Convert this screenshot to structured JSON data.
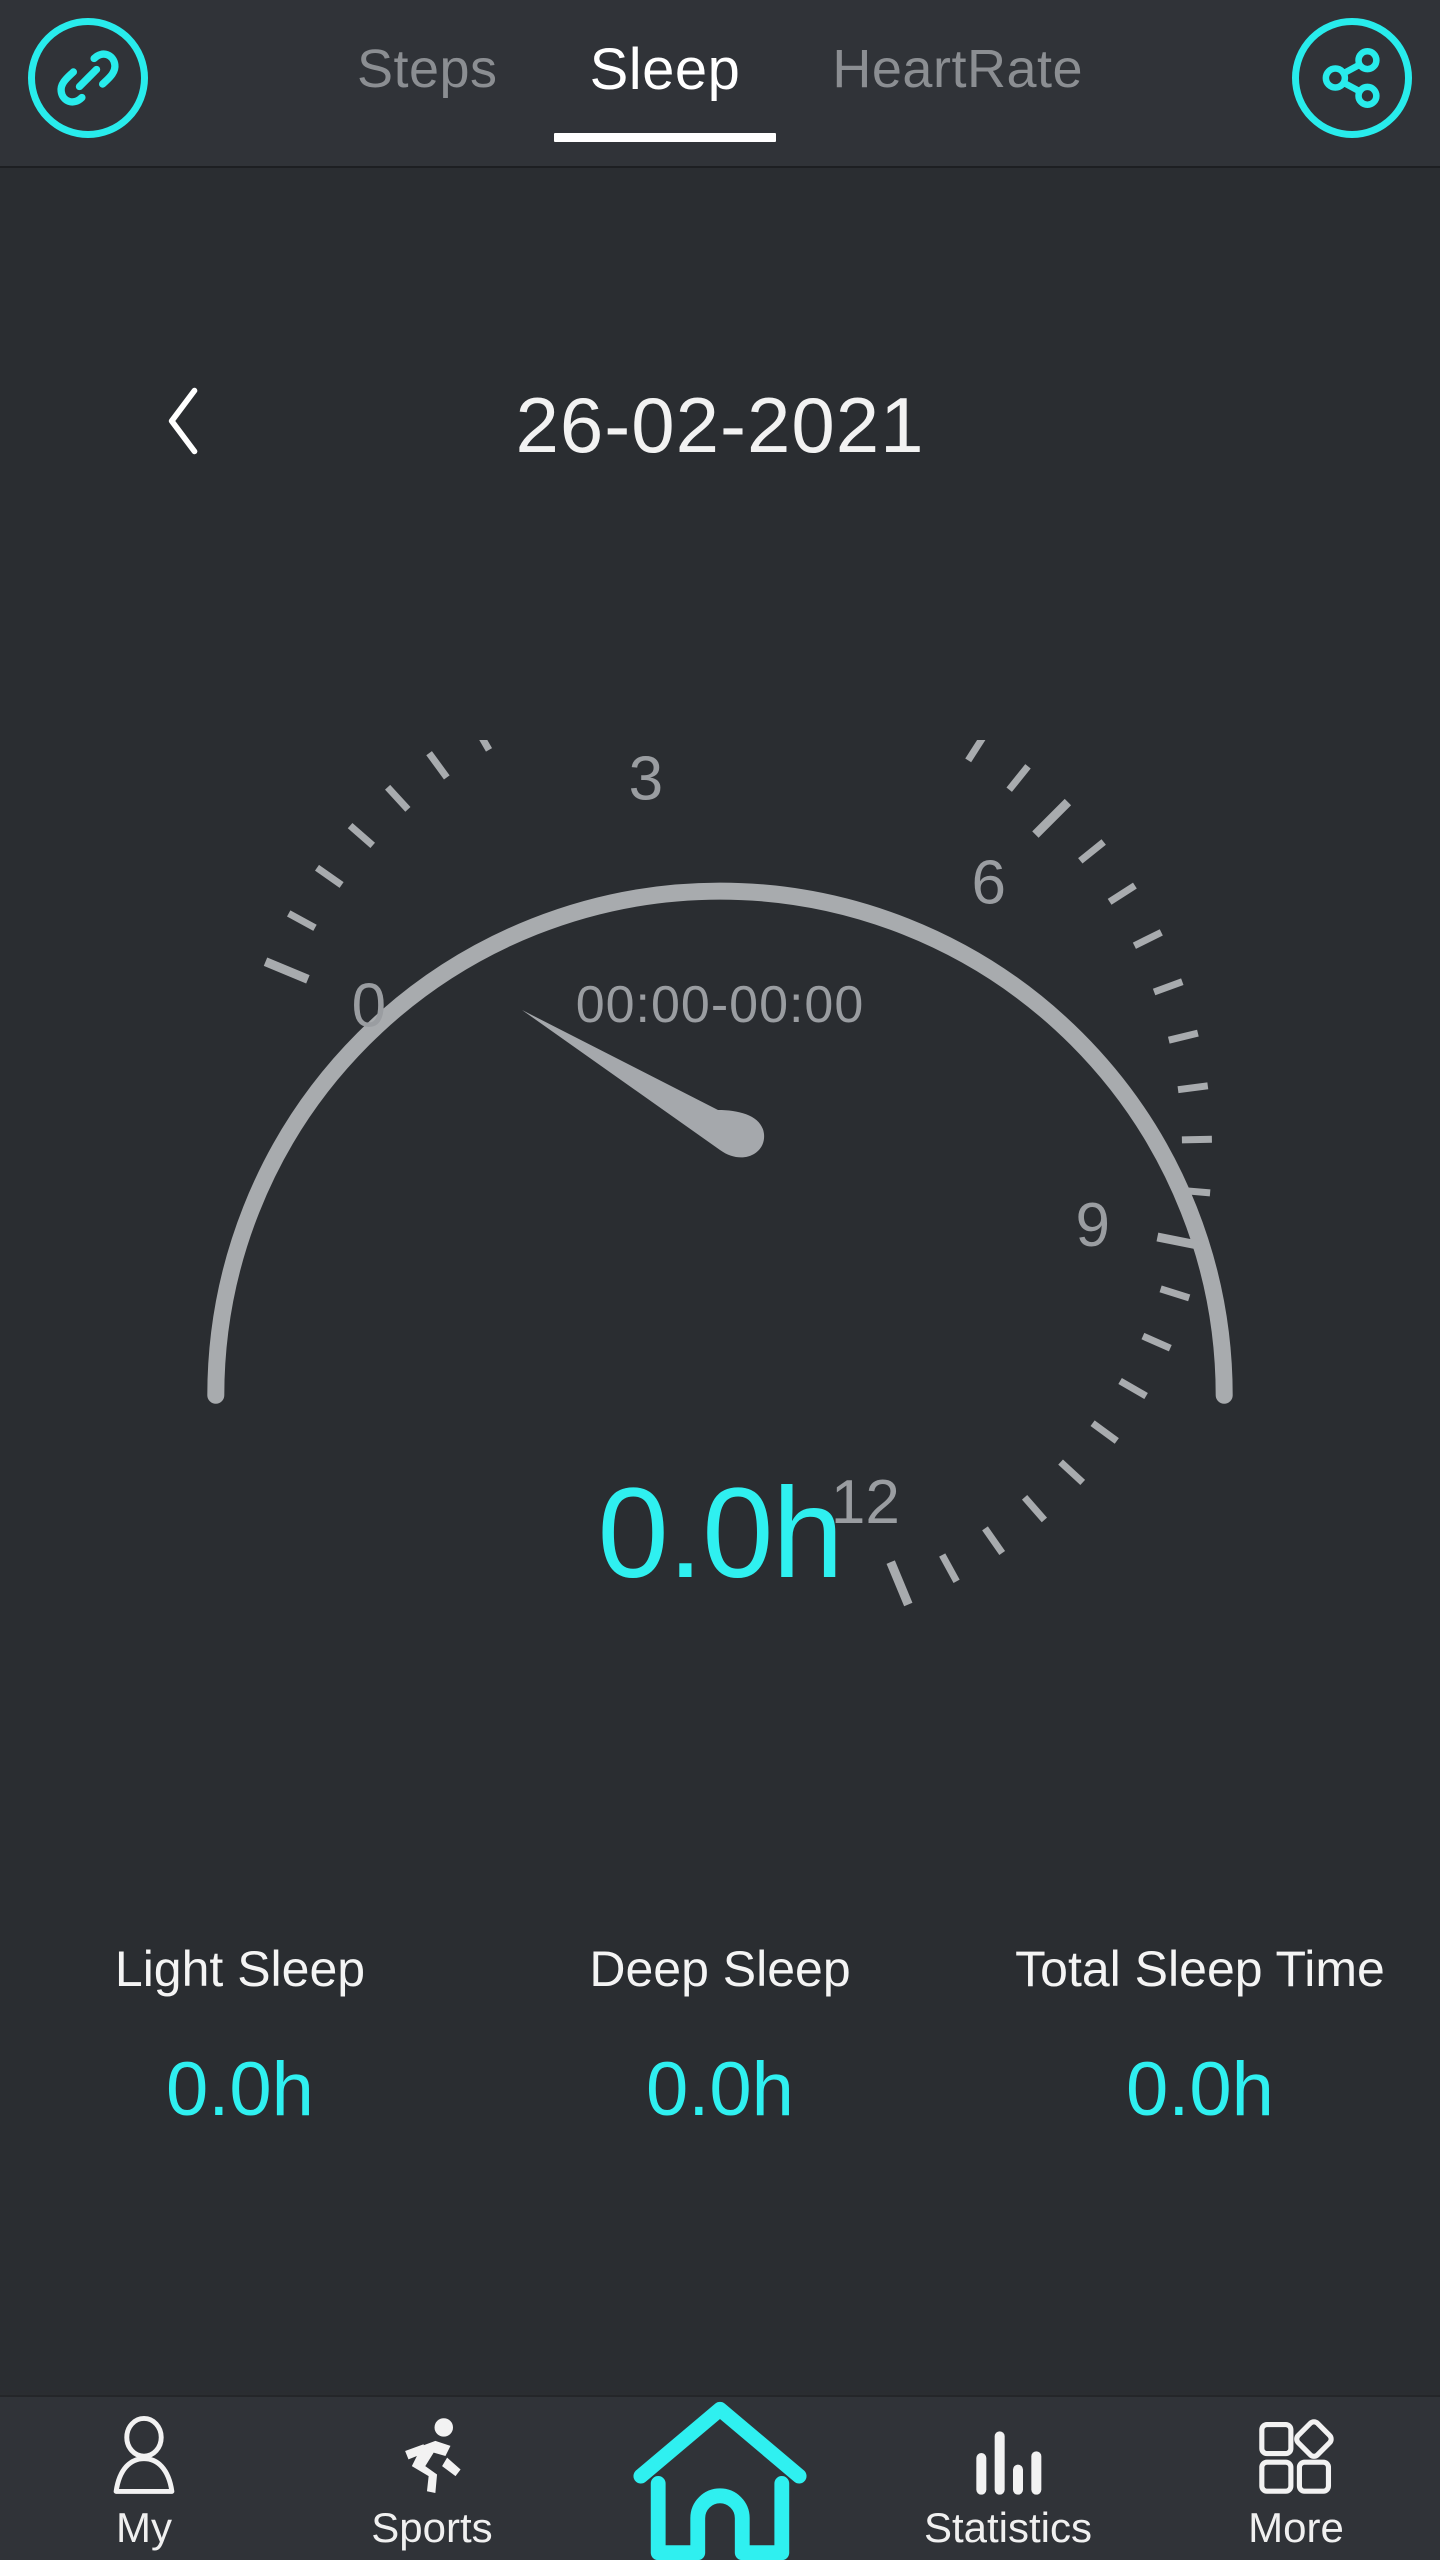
{
  "theme": {
    "accent": "#2ff0f0",
    "header_bg": "#303338",
    "body_bg": "#2a2d31",
    "gauge_gray": "#a8abae",
    "muted_text": "#8b8e92"
  },
  "topbar": {
    "link_icon": "chain-link-icon",
    "share_icon": "share-icon",
    "tabs": [
      {
        "label": "Steps",
        "active": false
      },
      {
        "label": "Sleep",
        "active": true
      },
      {
        "label": "HeartRate",
        "active": false
      }
    ]
  },
  "date_nav": {
    "back_icon": "chevron-left-icon",
    "date": "26-02-2021"
  },
  "gauge": {
    "time_range": "00:00-00:00",
    "value": "0.0h",
    "tick_labels": [
      "0",
      "3",
      "6",
      "9",
      "12"
    ],
    "needle_icon": "gauge-needle"
  },
  "stats": [
    {
      "label": "Light Sleep",
      "value": "0.0h"
    },
    {
      "label": "Deep Sleep",
      "value": "0.0h"
    },
    {
      "label": "Total Sleep Time",
      "value": "0.0h"
    }
  ],
  "bottom_nav": [
    {
      "label": "My",
      "icon": "person-icon",
      "active": false
    },
    {
      "label": "Sports",
      "icon": "runner-icon",
      "active": false
    },
    {
      "label": "",
      "icon": "home-icon",
      "active": true
    },
    {
      "label": "Statistics",
      "icon": "bar-chart-icon",
      "active": false
    },
    {
      "label": "More",
      "icon": "grid-icon",
      "active": false
    }
  ],
  "chart_data": {
    "type": "gauge",
    "title": "Sleep duration gauge",
    "value": 0.0,
    "unit": "h",
    "min": 0,
    "max": 12,
    "major_ticks": [
      0,
      3,
      6,
      9,
      12
    ],
    "minor_tick_count": 36,
    "start_angle_deg": 157.5,
    "sweep_deg": 225,
    "annotation": "00:00-00:00",
    "series": [
      {
        "name": "Light Sleep",
        "value": 0.0
      },
      {
        "name": "Deep Sleep",
        "value": 0.0
      },
      {
        "name": "Total Sleep Time",
        "value": 0.0
      }
    ]
  }
}
